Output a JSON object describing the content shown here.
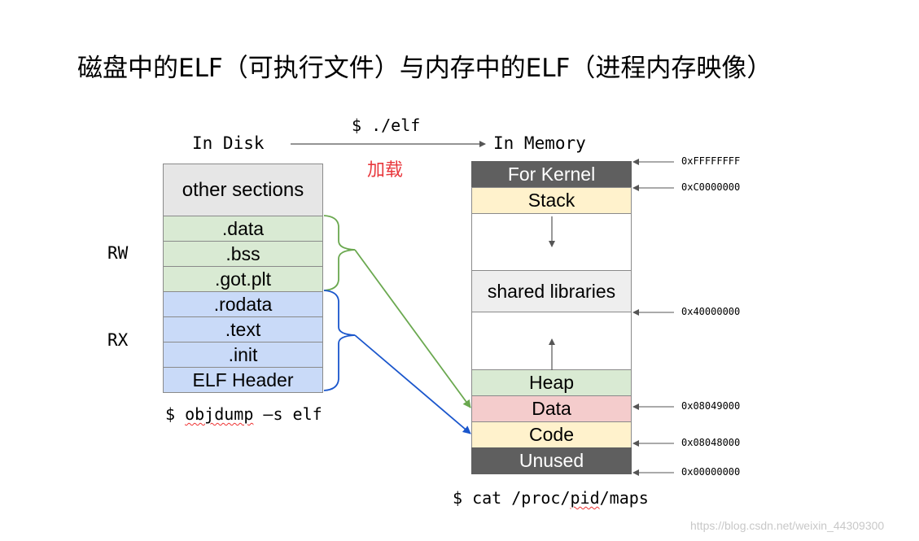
{
  "title": "磁盘中的ELF（可执行文件）与内存中的ELF（进程内存映像）",
  "disk_label": "In Disk",
  "memory_label": "In Memory",
  "run_command": "$ ./elf",
  "load_label": "加载",
  "disk_sections": [
    {
      "label": "other sections",
      "color": "#e6e6e6"
    },
    {
      "label": ".data",
      "color": "#d9ead3"
    },
    {
      "label": ".bss",
      "color": "#d9ead3"
    },
    {
      "label": ".got.plt",
      "color": "#d9ead3"
    },
    {
      "label": ".rodata",
      "color": "#c9daf8"
    },
    {
      "label": ".text",
      "color": "#c9daf8"
    },
    {
      "label": ".init",
      "color": "#c9daf8"
    },
    {
      "label": "ELF Header",
      "color": "#c9daf8"
    }
  ],
  "perm_rw": "RW",
  "perm_rx": "RX",
  "objdump_cmd": {
    "prefix": "$ ",
    "word": "objdump",
    "suffix": " –s elf"
  },
  "memory_segments": [
    {
      "label": "For Kernel",
      "color": "#5f5f5f",
      "text_color": "#ffffff"
    },
    {
      "label": "Stack",
      "color": "#fff2cc",
      "text_color": "#000000"
    },
    {
      "label": "",
      "color": "#ffffff",
      "text_color": "#000000"
    },
    {
      "label": "shared libraries",
      "color": "#eeeeee",
      "text_color": "#000000"
    },
    {
      "label": "",
      "color": "#ffffff",
      "text_color": "#000000"
    },
    {
      "label": "Heap",
      "color": "#d9ead3",
      "text_color": "#000000"
    },
    {
      "label": "Data",
      "color": "#f4cccc",
      "text_color": "#000000"
    },
    {
      "label": "Code",
      "color": "#fff2cc",
      "text_color": "#000000"
    },
    {
      "label": "Unused",
      "color": "#5f5f5f",
      "text_color": "#ffffff"
    }
  ],
  "addresses": [
    "0xFFFFFFFF",
    "0xC0000000",
    "0x40000000",
    "0x08049000",
    "0x08048000",
    "0x00000000"
  ],
  "maps_cmd": {
    "prefix": "$ cat /proc/",
    "word": "pid",
    "suffix": "/maps"
  },
  "colors": {
    "rw_arrow": "#6aa84f",
    "rx_arrow": "#1a56cc",
    "arrow_gray": "#555555"
  },
  "watermark": "https://blog.csdn.net/weixin_44309300"
}
